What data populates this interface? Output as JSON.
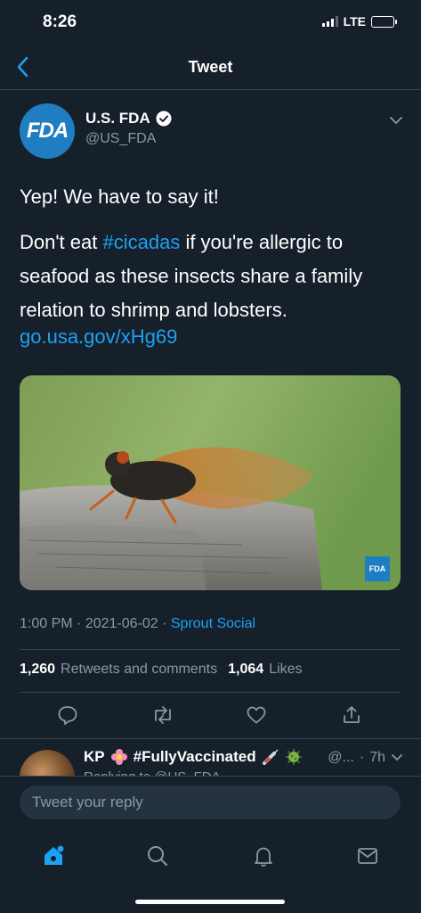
{
  "status_bar": {
    "time": "8:26",
    "network": "LTE"
  },
  "nav": {
    "title": "Tweet",
    "back_icon": "chevron-left-icon"
  },
  "tweet": {
    "avatar_text": "FDA",
    "author_name": "U.S. FDA",
    "handle": "@US_FDA",
    "line1": "Yep! We have to say it!",
    "body_prefix": "Don't eat ",
    "hashtag": "#cicadas",
    "body_suffix": " if you're allergic to seafood as these insects share a family relation to shrimp and lobsters.",
    "link": "go.usa.gov/xHg69",
    "image_badge": "FDA",
    "time": "1:00 PM",
    "date": "2021-06-02",
    "source": "Sprout Social",
    "retweets": "1,260",
    "retweets_label": "Retweets and comments",
    "likes": "1,064",
    "likes_label": "Likes"
  },
  "reply": {
    "name": "KP",
    "hashtag": "#FullyVaccinated",
    "handle": "@...",
    "time": "7h",
    "sub": "Replying to @US_FDA"
  },
  "composer": {
    "placeholder": "Tweet your reply"
  },
  "colors": {
    "background": "#15202b",
    "accent": "#1da1f2",
    "muted": "#8899a6",
    "divider": "#38444d"
  }
}
